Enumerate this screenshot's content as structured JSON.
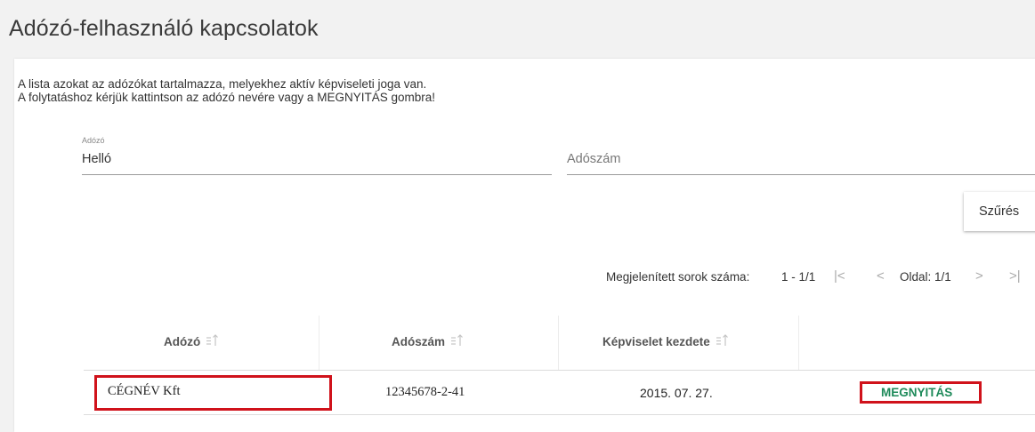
{
  "page": {
    "title": "Adózó-felhasználó kapcsolatok"
  },
  "intro": {
    "line1": "A lista azokat az adózókat tartalmazza, melyekhez aktív képviseleti joga van.",
    "line2": "A folytatáshoz kérjük kattintson az adózó nevére vagy a MEGNYITÁS gombra!"
  },
  "filters": {
    "adozo_label": "Adózó",
    "adozo_value": "Helló",
    "adoszam_placeholder": "Adószám",
    "filter_button": "Szűrés"
  },
  "pager": {
    "rows_label": "Megjelenített sorok száma:",
    "rows_value": "1 - 1/1",
    "first_icon": "|<",
    "prev_icon": "<",
    "page_label": "Oldal: 1/1",
    "next_icon": ">",
    "last_icon": ">|"
  },
  "table": {
    "columns": [
      "Adózó",
      "Adószám",
      "Képviselet kezdete"
    ],
    "rows": [
      {
        "adozo": "CÉGNÉV Kft",
        "adoszam": "12345678-2-41",
        "kezdete": "2015. 07. 27.",
        "action": "MEGNYITÁS"
      }
    ]
  },
  "colors": {
    "highlight_box": "#d0121b",
    "action_link": "#1e8a5a"
  }
}
